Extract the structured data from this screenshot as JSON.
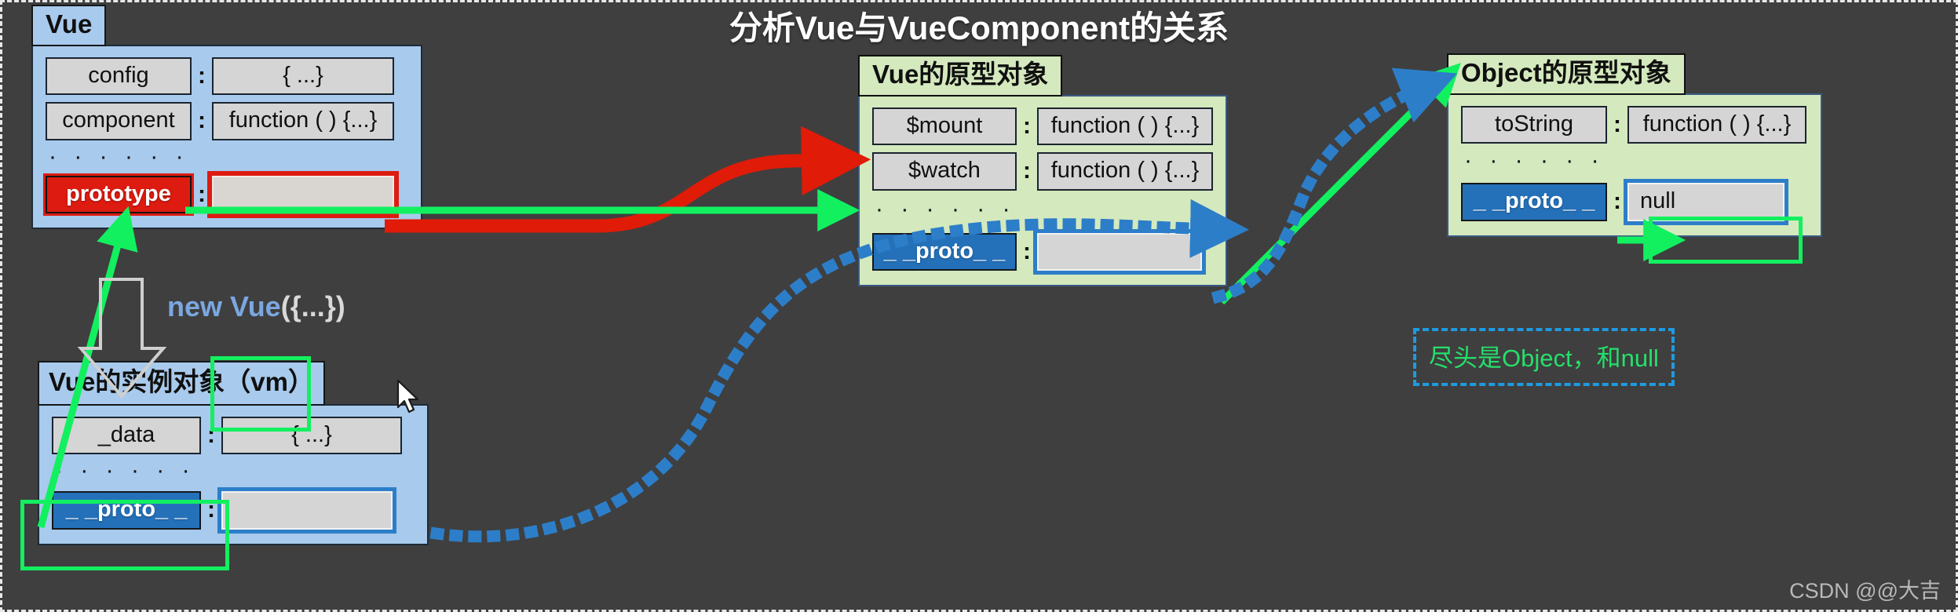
{
  "title": "分析Vue与VueComponent的关系",
  "watermark": "CSDN @@大吉",
  "colors": {
    "background": "#3f3f3f",
    "blue_box": "#a8caec",
    "green_box": "#d4e9bd",
    "cell": "#d5d5d5",
    "red_highlight": "#dd1b10",
    "blue_highlight": "#2471ba",
    "green_arrow": "#12f060",
    "blue_dotted_arrow": "#2d7ec9",
    "red_arrow": "#e01b08",
    "note_border": "#1f9ae0",
    "note_text": "#25e06a"
  },
  "boxes": {
    "vue": {
      "header": "Vue",
      "rows": [
        {
          "key": "config",
          "colon": ":",
          "value": "{ ...}"
        },
        {
          "key": "component",
          "colon": ":",
          "value": "function ( ) {...}"
        }
      ],
      "dots": "· · · · · ·",
      "proto_row": {
        "key": "prototype",
        "colon": ":",
        "value": ""
      }
    },
    "vue_prototype": {
      "header": "Vue的原型对象",
      "rows": [
        {
          "key": "$mount",
          "colon": ":",
          "value": "function ( ) {...}"
        },
        {
          "key": "$watch",
          "colon": ":",
          "value": "function ( ) {...}"
        }
      ],
      "dots": "· · · · · ·",
      "proto_row": {
        "key": "_ _proto_ _",
        "colon": ":",
        "value": ""
      }
    },
    "object_prototype": {
      "header": "Object的原型对象",
      "rows": [
        {
          "key": "toString",
          "colon": ":",
          "value": "function ( ) {...}"
        }
      ],
      "dots": "· · · · · ·",
      "proto_row": {
        "key": "_ _proto_ _",
        "colon": ":",
        "value": "null"
      }
    },
    "vue_instance": {
      "header": "Vue的实例对象（vm）",
      "rows": [
        {
          "key": "_data",
          "colon": ":",
          "value": "{ ...}"
        }
      ],
      "dots": "· · · · · ·",
      "proto_row": {
        "key": "_ _proto_ _",
        "colon": ":",
        "value": ""
      }
    }
  },
  "labels": {
    "new_vue_keyword": "new Vue",
    "new_vue_args": "({...})",
    "note": "尽头是Object，和null"
  }
}
